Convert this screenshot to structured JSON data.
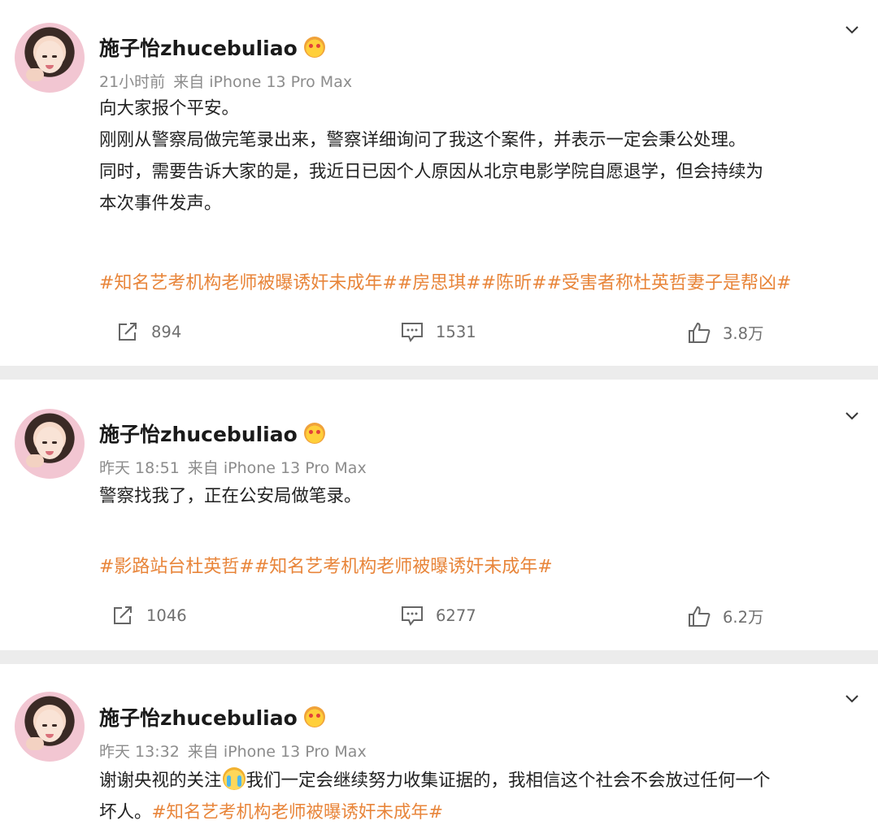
{
  "posts": [
    {
      "username": "施子怡zhucebuliao",
      "time": "21小时前",
      "source": "来自 iPhone 13 Pro Max",
      "lines": [
        "向大家报个平安。",
        "刚刚从警察局做完笔录出来，警察详细询问了我这个案件，并表示一定会秉公处理。",
        "同时，需要告诉大家的是，我近日已因个人原因从北京电影学院自愿退学，但会持续为",
        "本次事件发声。"
      ],
      "tags": "#知名艺考机构老师被曝诱奸未成年##房思琪##陈昕##受害者称杜英哲妻子是帮凶#",
      "reposts": "894",
      "comments": "1531",
      "likes": "3.8万"
    },
    {
      "username": "施子怡zhucebuliao",
      "time": "昨天 18:51",
      "source": "来自 iPhone 13 Pro Max",
      "lines": [
        "警察找我了，正在公安局做笔录。"
      ],
      "tags": "#影路站台杜英哲##知名艺考机构老师被曝诱奸未成年#",
      "reposts": "1046",
      "comments": "6277",
      "likes": "6.2万"
    },
    {
      "username": "施子怡zhucebuliao",
      "time": "昨天 13:32",
      "source": "来自 iPhone 13 Pro Max",
      "line1_before": "谢谢央视的关注",
      "line1_after": "我们一定会继续努力收集证据的，我相信这个社会不会放过任何一个",
      "line2": "坏人。",
      "line2_tag": "#知名艺考机构老师被曝诱奸未成年#"
    }
  ],
  "colors": {
    "tag": "#e8853a",
    "meta": "#8c8c8c",
    "separator": "#ececec"
  },
  "icons": [
    "chevron-down-icon",
    "repost-icon",
    "comment-icon",
    "like-icon",
    "crying-emoji-icon",
    "vip-badge-icon"
  ]
}
